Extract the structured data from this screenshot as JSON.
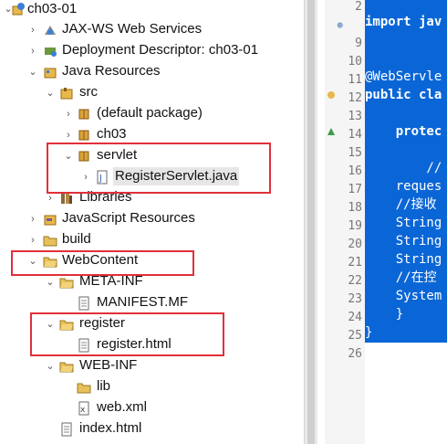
{
  "tree": {
    "project": "ch03-01",
    "jaxws": "JAX-WS Web Services",
    "deployment": "Deployment Descriptor: ch03-01",
    "java_resources": "Java Resources",
    "src": "src",
    "default_package": "(default package)",
    "ch03": "ch03",
    "servlet": "servlet",
    "register_servlet": "RegisterServlet.java",
    "libraries": "Libraries",
    "js_resources": "JavaScript Resources",
    "build": "build",
    "webcontent": "WebContent",
    "meta_inf": "META-INF",
    "manifest": "MANIFEST.MF",
    "register": "register",
    "register_html": "register.html",
    "web_inf": "WEB-INF",
    "lib": "lib",
    "web_xml": "web.xml",
    "index_html": "index.html"
  },
  "editor": {
    "line_numbers": [
      "2",
      "9",
      "10",
      "11",
      "12",
      "13",
      "14",
      "15",
      "16",
      "17",
      "18",
      "19",
      "20",
      "21",
      "22",
      "23",
      "24",
      "25",
      "26"
    ],
    "lines": [
      "import jav",
      "",
      "",
      "@WebServle",
      "public cla",
      "",
      "    protec",
      "",
      "        //",
      "    reques",
      "    //接收",
      "    String",
      "    String",
      "    String",
      "    //在控",
      "    System",
      "    }",
      "}",
      ""
    ]
  },
  "colors": {
    "selection": "#0a66d6",
    "highlight_box": "#e0303a"
  }
}
